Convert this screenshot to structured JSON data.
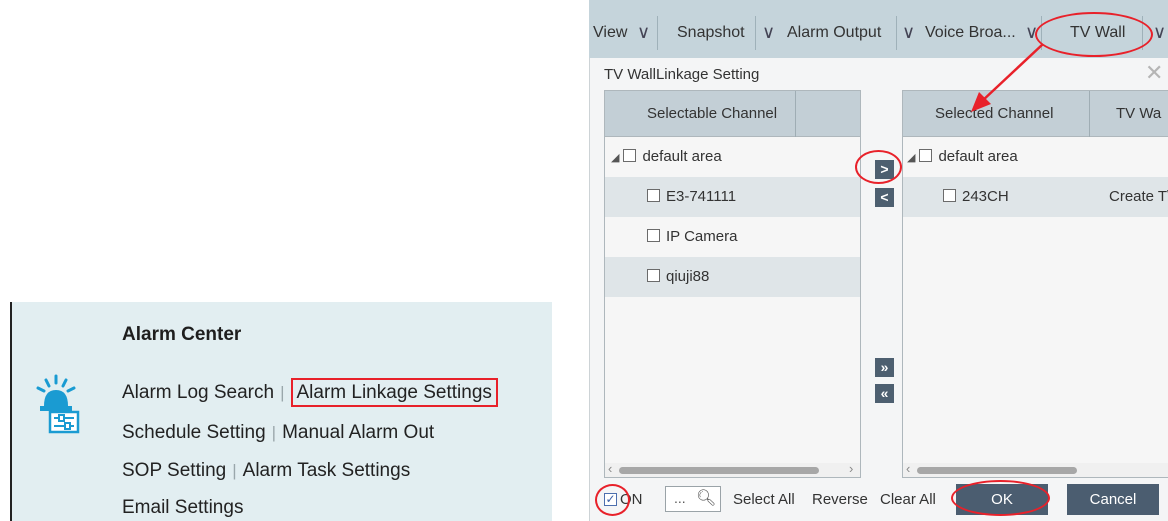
{
  "alarm_center": {
    "title": "Alarm Center",
    "rows": [
      [
        "Alarm Log Search",
        "Alarm Linkage Settings"
      ],
      [
        "Schedule Setting",
        "Manual Alarm Out"
      ],
      [
        "SOP Setting",
        "Alarm Task Settings"
      ],
      [
        "Email Settings"
      ]
    ],
    "highlighted": "Alarm Linkage Settings"
  },
  "toolbar": {
    "items": [
      "View",
      "Snapshot",
      "Alarm Output",
      "Voice Broa...",
      "TV Wall"
    ],
    "highlighted": "TV Wall"
  },
  "dialog": {
    "title": "TV WallLinkage Setting",
    "left_panel": {
      "column": "Selectable Channel",
      "group": "default area",
      "items": [
        "E3-741111",
        "IP Camera",
        "qiuji88"
      ]
    },
    "right_panel": {
      "columns": [
        "Selected Channel",
        "TV Wa"
      ],
      "group": "default area",
      "items": [
        {
          "channel": "243CH",
          "tvwall": "Create T\\"
        }
      ]
    },
    "move_buttons": {
      "add": ">",
      "remove": "<",
      "add_all": "»",
      "remove_all": "«"
    },
    "bottom": {
      "on_label": "ON",
      "search_dots": "...",
      "select_all": "Select All",
      "reverse": "Reverse",
      "clear_all": "Clear All",
      "ok": "OK",
      "cancel": "Cancel"
    }
  },
  "colors": {
    "highlight_red": "#e8212a",
    "button_dark": "#4b5d70",
    "header_blue_gray": "#c3cfd6",
    "alarm_panel_bg": "#e2eef1"
  }
}
